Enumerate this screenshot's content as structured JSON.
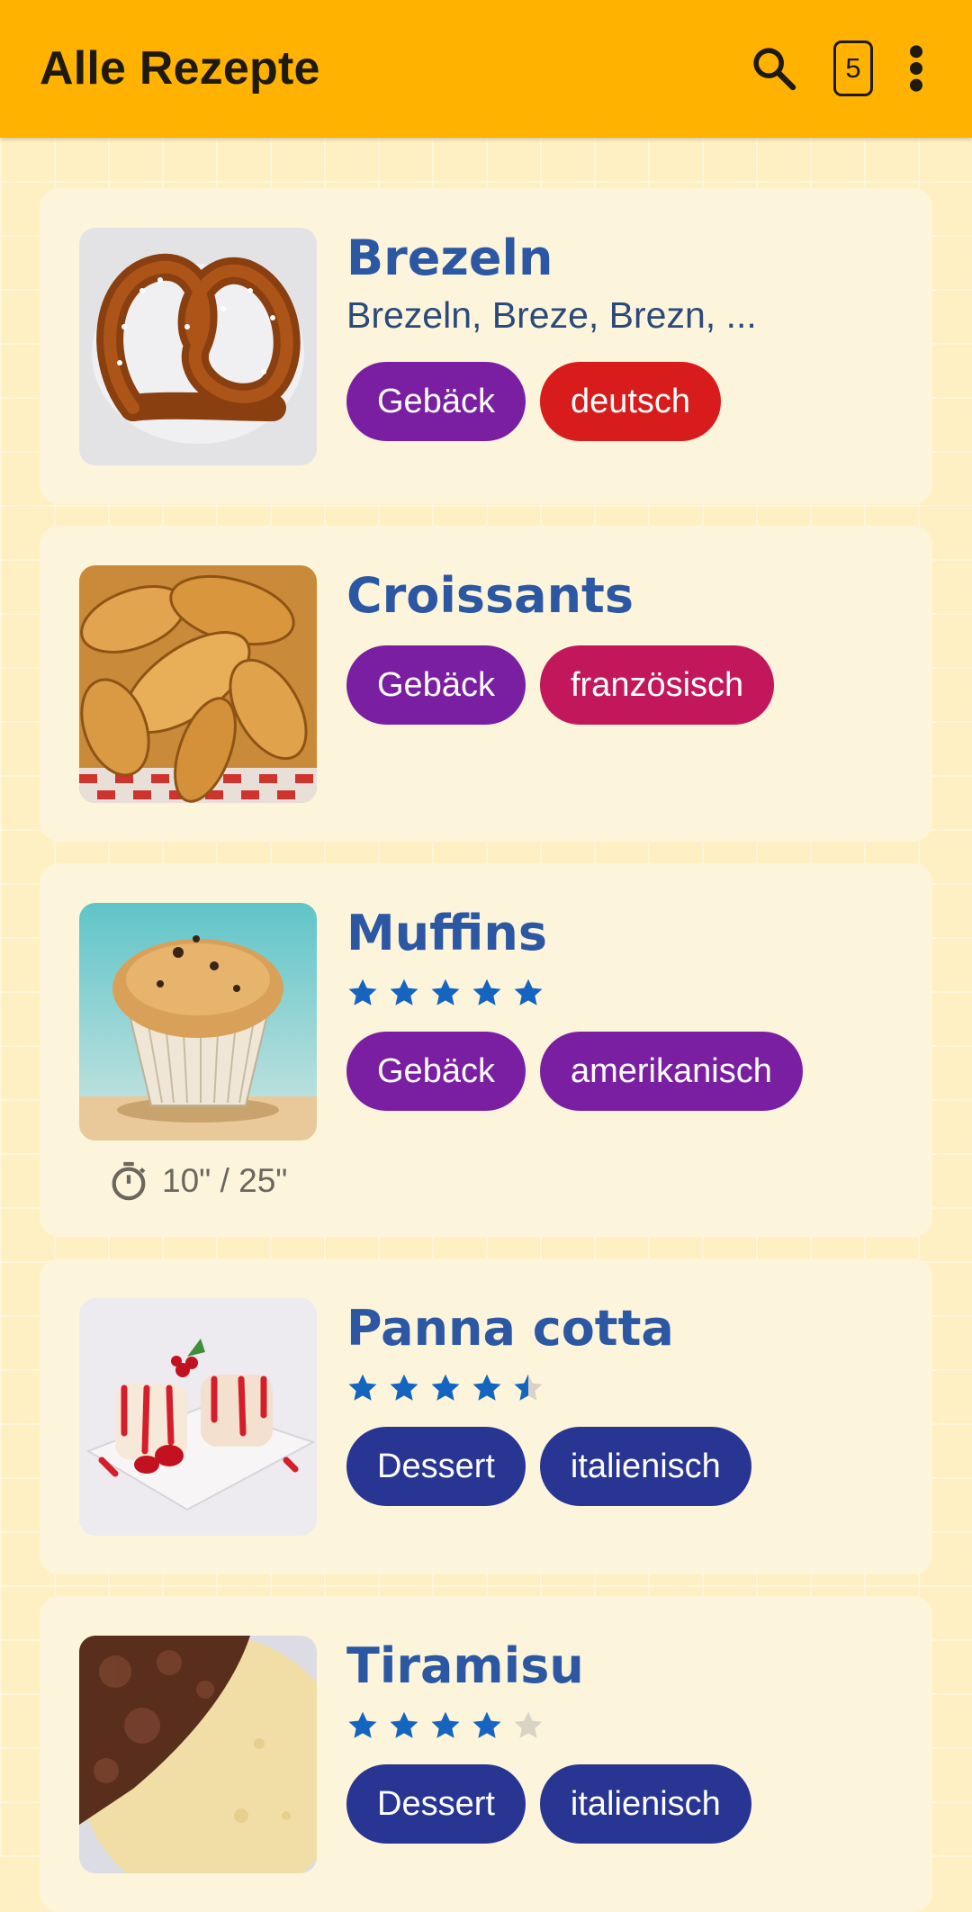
{
  "app_bar": {
    "title": "Alle Rezepte",
    "search_icon": "search-icon",
    "count": "5",
    "more_icon": "more-vert-icon",
    "color": "#FFB300"
  },
  "recipes": [
    {
      "name": "Brezeln",
      "subtitle": "Brezeln, Breze, Brezn, ...",
      "image": "pretzel-photo",
      "tags": [
        {
          "label": "Gebäck",
          "color": "#7B1FA2"
        },
        {
          "label": "deutsch",
          "color": "#D81B1B"
        }
      ]
    },
    {
      "name": "Croissants",
      "image": "croissants-photo",
      "tags": [
        {
          "label": "Gebäck",
          "color": "#7B1FA2"
        },
        {
          "label": "französisch",
          "color": "#C2185B"
        }
      ]
    },
    {
      "name": "Muffins",
      "image": "muffin-photo",
      "rating": 5,
      "tags": [
        {
          "label": "Gebäck",
          "color": "#7B1FA2"
        },
        {
          "label": "amerikanisch",
          "color": "#7B1FA2"
        }
      ],
      "time": "10\" / 25\""
    },
    {
      "name": "Panna cotta",
      "image": "panna-cotta-photo",
      "rating": 4.5,
      "tags": [
        {
          "label": "Dessert",
          "color": "#283593"
        },
        {
          "label": "italienisch",
          "color": "#283593"
        }
      ]
    },
    {
      "name": "Tiramisu",
      "image": "tiramisu-photo",
      "rating": 4,
      "tags": [
        {
          "label": "Dessert",
          "color": "#283593"
        },
        {
          "label": "italienisch",
          "color": "#283593"
        }
      ]
    }
  ],
  "colors": {
    "title": "#2B57A3",
    "star": "#1565C0",
    "star_empty": "#D8D3C5",
    "card": "#FDF4DC",
    "background": "#FFF0C4"
  }
}
